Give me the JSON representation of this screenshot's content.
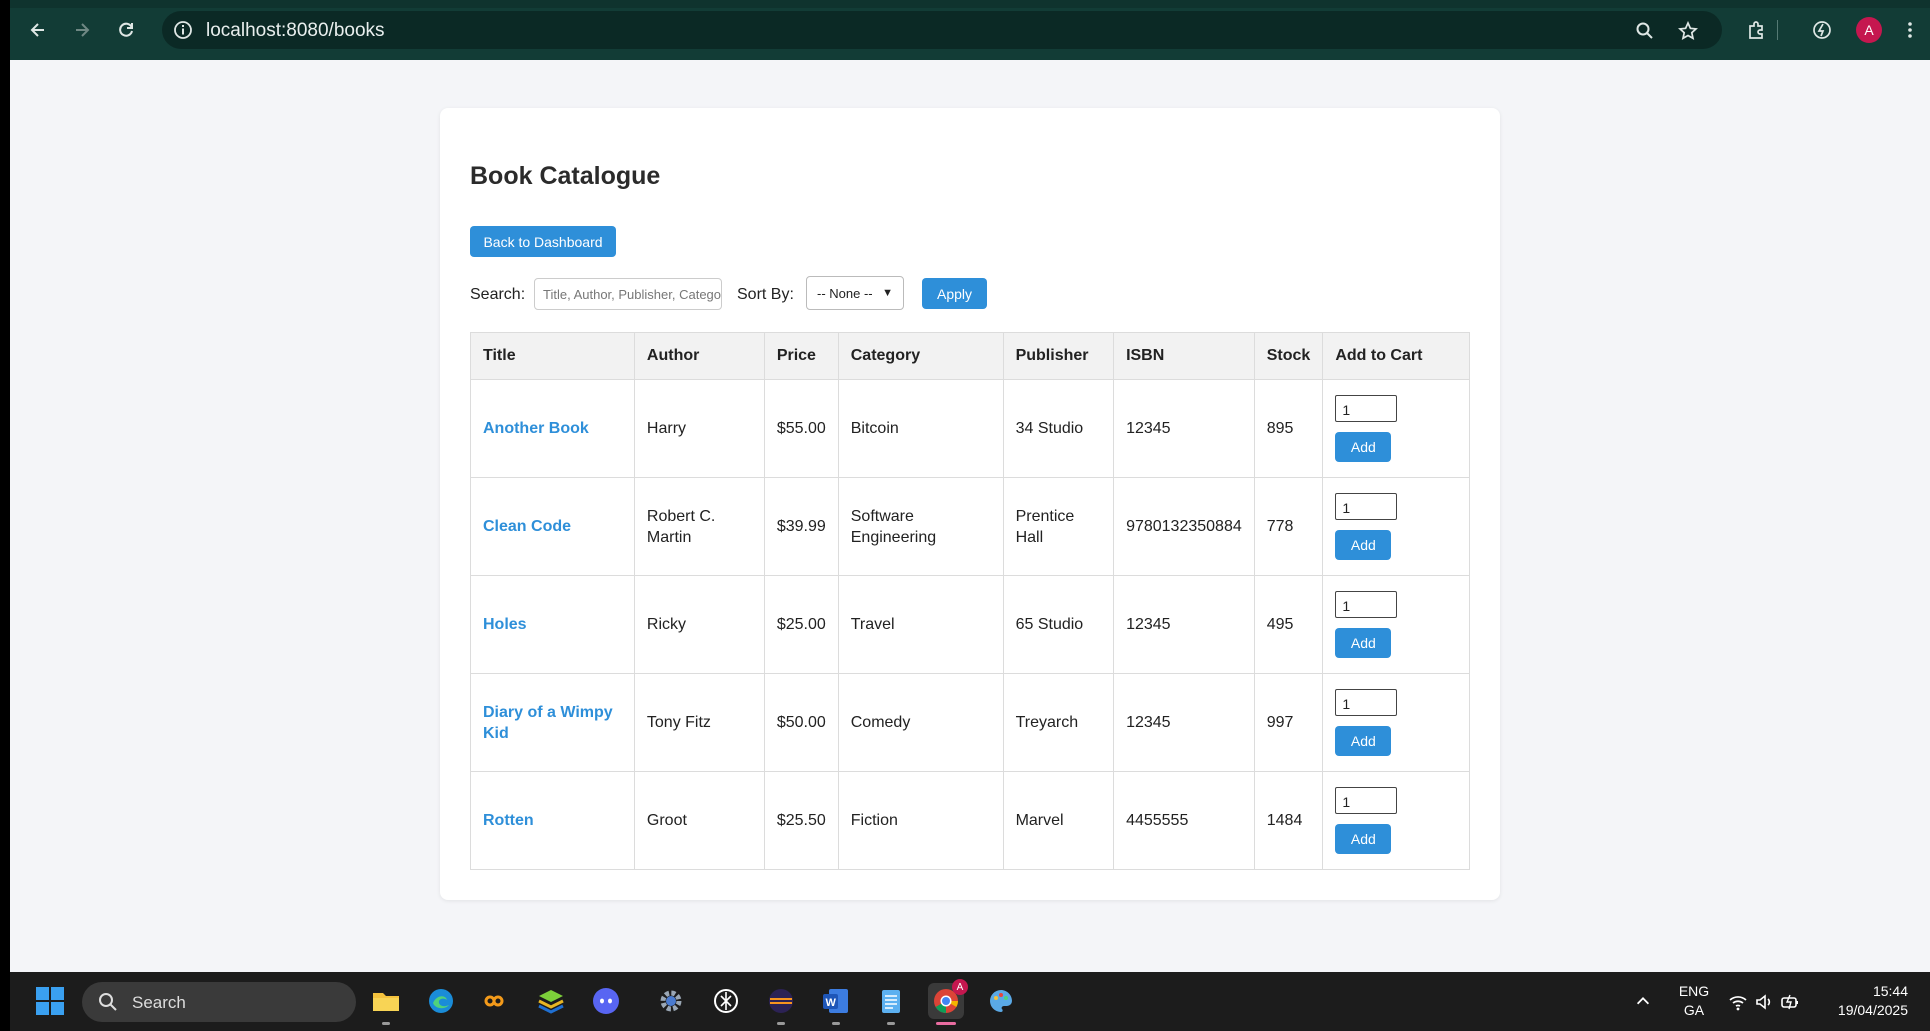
{
  "browser": {
    "url": "localhost:8080/books",
    "profile_initial": "A"
  },
  "page": {
    "title": "Book Catalogue",
    "back_button": "Back to Dashboard",
    "search_label": "Search:",
    "search_placeholder": "Title, Author, Publisher, Category",
    "sort_label": "Sort By:",
    "sort_selected": "-- None --",
    "apply_button": "Apply"
  },
  "table": {
    "headers": [
      "Title",
      "Author",
      "Price",
      "Category",
      "Publisher",
      "ISBN",
      "Stock",
      "Add to Cart"
    ],
    "rows": [
      {
        "title": "Another Book",
        "author": "Harry",
        "price": "$55.00",
        "category": "Bitcoin",
        "publisher": "34 Studio",
        "isbn": "12345",
        "stock": "895",
        "qty": "1",
        "add": "Add"
      },
      {
        "title": "Clean Code",
        "author": "Robert C. Martin",
        "price": "$39.99",
        "category": "Software Engineering",
        "publisher": "Prentice Hall",
        "isbn": "9780132350884",
        "stock": "778",
        "qty": "1",
        "add": "Add"
      },
      {
        "title": "Holes",
        "author": "Ricky",
        "price": "$25.00",
        "category": "Travel",
        "publisher": "65 Studio",
        "isbn": "12345",
        "stock": "495",
        "qty": "1",
        "add": "Add"
      },
      {
        "title": "Diary of a Wimpy Kid",
        "author": "Tony Fitz",
        "price": "$50.00",
        "category": "Comedy",
        "publisher": "Treyarch",
        "isbn": "12345",
        "stock": "997",
        "qty": "1",
        "add": "Add"
      },
      {
        "title": "Rotten",
        "author": "Groot",
        "price": "$25.50",
        "category": "Fiction",
        "publisher": "Marvel",
        "isbn": "4455555",
        "stock": "1484",
        "qty": "1",
        "add": "Add"
      }
    ]
  },
  "taskbar": {
    "search_text": "Search",
    "lang_line1": "ENG",
    "lang_line2": "GA",
    "time": "15:44",
    "date": "19/04/2025",
    "chrome_badge": "A"
  },
  "colors": {
    "accent": "#2e8fd9",
    "chrome_bg": "#123c36",
    "page_bg": "#f4f5f8"
  }
}
